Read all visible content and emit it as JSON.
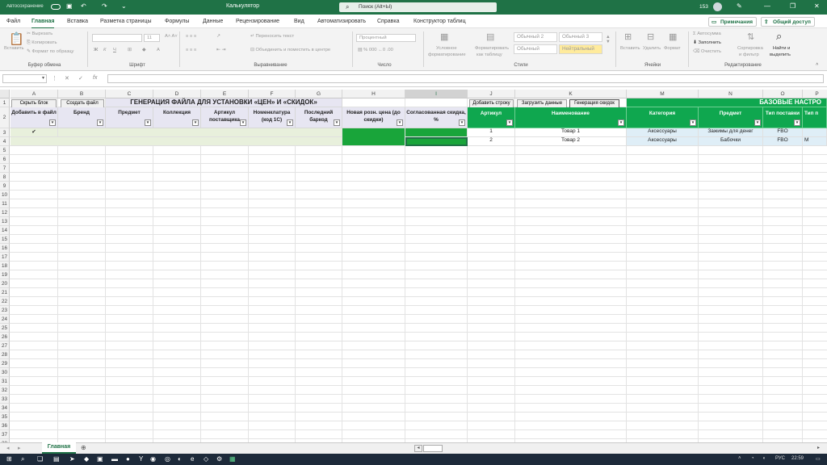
{
  "titlebar": {
    "autosave": "Автосохранение",
    "title": "Калькулятор",
    "search": "Поиск (Alt+Ы)",
    "count": "153"
  },
  "menu": {
    "items": [
      "Файл",
      "Главная",
      "Вставка",
      "Разметка страницы",
      "Формулы",
      "Данные",
      "Рецензирование",
      "Вид",
      "Автоматизировать",
      "Справка",
      "Конструктор таблиц"
    ],
    "notes": "Примечания",
    "share": "Общий доступ"
  },
  "ribbon": {
    "paste": "Вставить",
    "cut": "Вырезать",
    "copy": "Копировать",
    "format_painter": "Формат по образцу",
    "clipboard": "Буфер обмена",
    "font_size": "11",
    "font": "Шрифт",
    "wrap": "Переносить текст",
    "merge": "Объединить и поместить в центре",
    "alignment": "Выравнивание",
    "number_format": "Процентный",
    "number": "Число",
    "cond_format_1": "Условное",
    "cond_format_2": "форматирование",
    "format_table_1": "Форматировать",
    "format_table_2": "как таблицу",
    "style1": "Обычный 2",
    "style2": "Обычный 3",
    "style3": "Обычный",
    "style4": "Нейтральный",
    "styles": "Стили",
    "insert": "Вставить",
    "delete": "Удалить",
    "format": "Формат",
    "cells": "Ячейки",
    "autosum": "Автосумма",
    "fill": "Заполнить",
    "clear": "Очистить",
    "sort_1": "Сортировка",
    "sort_2": "и фильтр",
    "find_1": "Найти и",
    "find_2": "выделить",
    "editing": "Редактирование"
  },
  "formula": {
    "name_box": "",
    "content": ""
  },
  "columns": [
    "A",
    "B",
    "C",
    "D",
    "E",
    "F",
    "G",
    "H",
    "I",
    "J",
    "K",
    "M",
    "N",
    "O",
    "P"
  ],
  "row_numbers": [
    "1",
    "2",
    "3",
    "4",
    "5",
    "6",
    "7",
    "8",
    "9",
    "10",
    "11",
    "12",
    "13",
    "14",
    "15",
    "16",
    "17",
    "18",
    "19",
    "20",
    "21",
    "22",
    "23",
    "24",
    "25",
    "26",
    "27",
    "28",
    "29",
    "30",
    "31",
    "32",
    "33",
    "34",
    "35",
    "36",
    "37",
    "38"
  ],
  "sheet": {
    "btn_hide": "Скрыть блок",
    "btn_create": "Создать файл",
    "main_title": "ГЕНЕРАЦИЯ ФАЙЛА ДЛЯ УСТАНОВКИ «ЦЕН» И «СКИДОК»",
    "btn_add_row": "Добавить строку",
    "btn_load": "Загрузить данные",
    "btn_gen": "Генерация скидок",
    "base_title": "БАЗОВЫЕ НАСТРО",
    "headers_left": [
      "Добавить в файл",
      "Бренд",
      "Предмет",
      "Коллекция",
      "Артикул поставщика",
      "Номенклатура (код 1С)",
      "Последний баркод",
      "Новая розн. цена (до скидки)",
      "Согласованная скидка, %"
    ],
    "headers_right": [
      "Артикул",
      "Наименование",
      "Категория",
      "Предмет",
      "Тип поставки",
      "Тип п"
    ],
    "row3": {
      "check": "✔",
      "article": "1",
      "name": "Товар 1",
      "category": "Аксессуары",
      "subject": "Зажимы для денег",
      "supply": "FBO"
    },
    "row4": {
      "article": "2",
      "name": "Товар 2",
      "category": "Аксессуары",
      "subject": "Бабочки",
      "supply": "FBO",
      "extra": "М"
    }
  },
  "sheetbar": {
    "tab": "Главная"
  },
  "taskbar": {
    "lang": "РУС",
    "time": "22:59"
  },
  "colors": {
    "excel_green": "#1f7246",
    "header_green": "#0fa74f",
    "header_purple": "#e7e6f2",
    "light_blue": "#dfeef7"
  }
}
